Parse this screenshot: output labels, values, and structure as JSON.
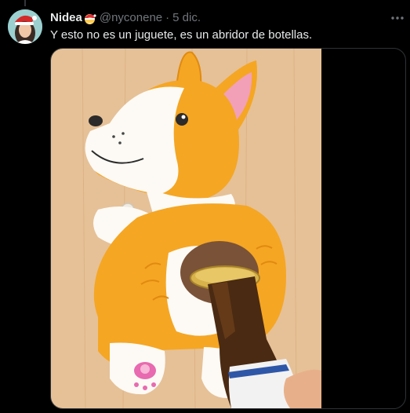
{
  "tweet": {
    "author_name": "Nidea",
    "author_emoji_icon": "santa-face-emoji-icon",
    "handle": "@nyconene",
    "separator": "·",
    "timestamp": "5 dic.",
    "text": "Y esto no es un juguete, es un abridor de botellas.",
    "more_icon": "more-dots-icon"
  },
  "media": {
    "description_icon": "corgi-bottle-opener-photo"
  },
  "colors": {
    "background": "#000000",
    "text_primary": "#e7e9ea",
    "text_secondary": "#71767b",
    "border": "#2f3336",
    "wood": "#e8c29a",
    "corgi_orange": "#f5a623",
    "corgi_white": "#fdfaf5",
    "ear_pink": "#f2a0b8"
  }
}
